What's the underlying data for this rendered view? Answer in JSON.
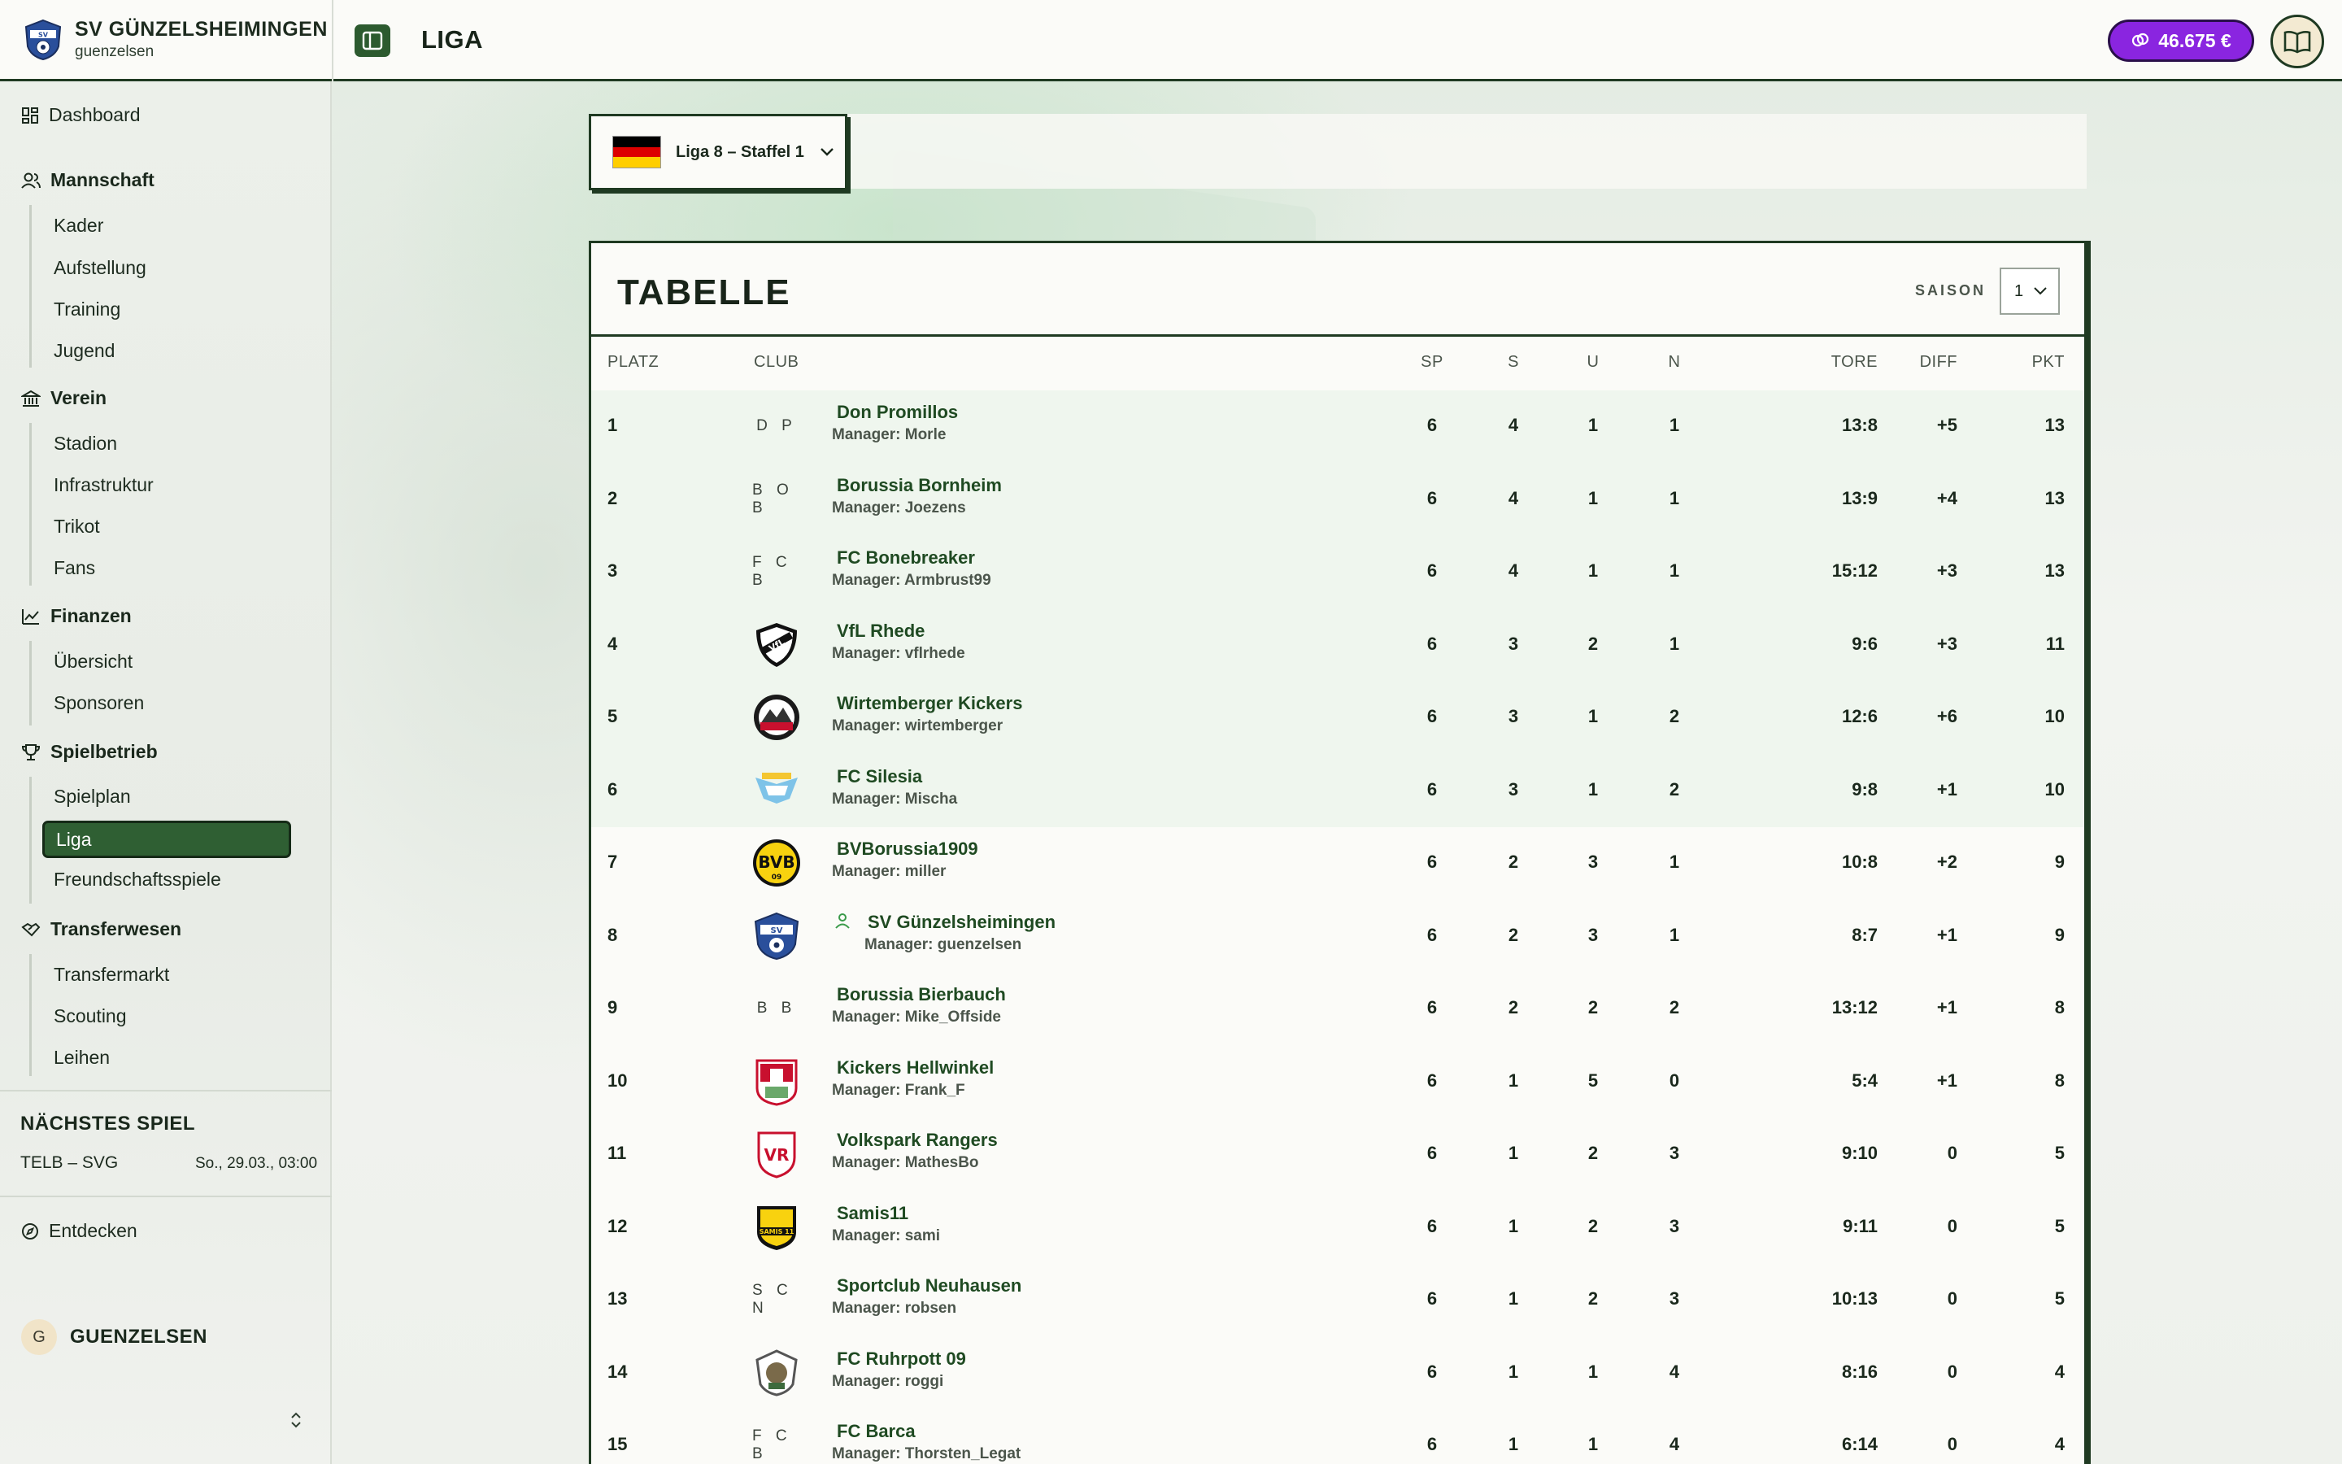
{
  "header": {
    "club_name": "SV GÜNZELSHEIMINGEN",
    "club_user": "guenzelsen",
    "page_title": "LIGA",
    "balance": "46.675 €"
  },
  "sidebar": {
    "dashboard": "Dashboard",
    "groups": [
      {
        "title": "Mannschaft",
        "icon": "users-icon",
        "items": [
          "Kader",
          "Aufstellung",
          "Training",
          "Jugend"
        ]
      },
      {
        "title": "Verein",
        "icon": "building-icon",
        "items": [
          "Stadion",
          "Infrastruktur",
          "Trikot",
          "Fans"
        ]
      },
      {
        "title": "Finanzen",
        "icon": "chart-icon",
        "items": [
          "Übersicht",
          "Sponsoren"
        ]
      },
      {
        "title": "Spielbetrieb",
        "icon": "trophy-icon",
        "items": [
          "Spielplan",
          "Liga",
          "Freundschaftsspiele"
        ]
      },
      {
        "title": "Transferwesen",
        "icon": "handshake-icon",
        "items": [
          "Transfermarkt",
          "Scouting",
          "Leihen"
        ]
      }
    ],
    "active_item": "Liga",
    "next_match_label": "NÄCHSTES SPIEL",
    "next_match": "TELB – SVG",
    "next_match_date": "So., 29.03., 03:00",
    "discover": "Entdecken",
    "user_initial": "G",
    "user_name": "GUENZELSEN"
  },
  "league": {
    "selected": "Liga 8 – Staffel 1",
    "flag_colors": [
      "#000000",
      "#dd0000",
      "#ffce00"
    ]
  },
  "table": {
    "title": "TABELLE",
    "season_label": "SAISON",
    "season_value": "1",
    "headers": [
      "PLATZ",
      "CLUB",
      "SP",
      "S",
      "U",
      "N",
      "TORE",
      "DIFF",
      "PKT"
    ],
    "rows": [
      {
        "pos": "1",
        "initials": "D P",
        "logo": "",
        "club": "Don Promillos",
        "manager": "Manager: Morle",
        "sp": "6",
        "s": "4",
        "u": "1",
        "n": "1",
        "tore": "13:8",
        "diff": "+5",
        "pkt": "13"
      },
      {
        "pos": "2",
        "initials": "B O B",
        "logo": "",
        "club": "Borussia Bornheim",
        "manager": "Manager: Joezens",
        "sp": "6",
        "s": "4",
        "u": "1",
        "n": "1",
        "tore": "13:9",
        "diff": "+4",
        "pkt": "13"
      },
      {
        "pos": "3",
        "initials": "F C B",
        "logo": "",
        "club": "FC Bonebreaker",
        "manager": "Manager: Armbrust99",
        "sp": "6",
        "s": "4",
        "u": "1",
        "n": "1",
        "tore": "15:12",
        "diff": "+3",
        "pkt": "13"
      },
      {
        "pos": "4",
        "initials": "",
        "logo": "vfl-rhede-crest-icon",
        "club": "VfL Rhede",
        "manager": "Manager: vflrhede",
        "sp": "6",
        "s": "3",
        "u": "2",
        "n": "1",
        "tore": "9:6",
        "diff": "+3",
        "pkt": "11"
      },
      {
        "pos": "5",
        "initials": "",
        "logo": "wirtemberger-kickers-crest-icon",
        "club": "Wirtemberger Kickers",
        "manager": "Manager: wirtemberger",
        "sp": "6",
        "s": "3",
        "u": "1",
        "n": "2",
        "tore": "12:6",
        "diff": "+6",
        "pkt": "10"
      },
      {
        "pos": "6",
        "initials": "",
        "logo": "fc-silesia-crest-icon",
        "club": "FC Silesia",
        "manager": "Manager: Mischa",
        "sp": "6",
        "s": "3",
        "u": "1",
        "n": "2",
        "tore": "9:8",
        "diff": "+1",
        "pkt": "10"
      },
      {
        "pos": "7",
        "initials": "",
        "logo": "bvb-crest-icon",
        "club": "BVBorussia1909",
        "manager": "Manager: miller",
        "sp": "6",
        "s": "2",
        "u": "3",
        "n": "1",
        "tore": "10:8",
        "diff": "+2",
        "pkt": "9"
      },
      {
        "pos": "8",
        "initials": "",
        "logo": "sv-guenzelsheimingen-crest-icon",
        "club": "SV Günzelsheimingen",
        "manager": "Manager: guenzelsen",
        "own": true,
        "sp": "6",
        "s": "2",
        "u": "3",
        "n": "1",
        "tore": "8:7",
        "diff": "+1",
        "pkt": "9"
      },
      {
        "pos": "9",
        "initials": "B B",
        "logo": "",
        "club": "Borussia Bierbauch",
        "manager": "Manager: Mike_Offside",
        "sp": "6",
        "s": "2",
        "u": "2",
        "n": "2",
        "tore": "13:12",
        "diff": "+1",
        "pkt": "8"
      },
      {
        "pos": "10",
        "initials": "",
        "logo": "kickers-hellwinkel-crest-icon",
        "club": "Kickers Hellwinkel",
        "manager": "Manager: Frank_F",
        "sp": "6",
        "s": "1",
        "u": "5",
        "n": "0",
        "tore": "5:4",
        "diff": "+1",
        "pkt": "8"
      },
      {
        "pos": "11",
        "initials": "",
        "logo": "volkspark-rangers-crest-icon",
        "club": "Volkspark Rangers",
        "manager": "Manager: MathesBo",
        "sp": "6",
        "s": "1",
        "u": "2",
        "n": "3",
        "tore": "9:10",
        "diff": "0",
        "pkt": "5"
      },
      {
        "pos": "12",
        "initials": "",
        "logo": "samis11-crest-icon",
        "club": "Samis11",
        "manager": "Manager: sami",
        "sp": "6",
        "s": "1",
        "u": "2",
        "n": "3",
        "tore": "9:11",
        "diff": "0",
        "pkt": "5"
      },
      {
        "pos": "13",
        "initials": "S C N",
        "logo": "",
        "club": "Sportclub Neuhausen",
        "manager": "Manager: robsen",
        "sp": "6",
        "s": "1",
        "u": "2",
        "n": "3",
        "tore": "10:13",
        "diff": "0",
        "pkt": "5"
      },
      {
        "pos": "14",
        "initials": "",
        "logo": "fc-ruhrpott-09-crest-icon",
        "club": "FC Ruhrpott 09",
        "manager": "Manager: roggi",
        "sp": "6",
        "s": "1",
        "u": "1",
        "n": "4",
        "tore": "8:16",
        "diff": "0",
        "pkt": "4"
      },
      {
        "pos": "15",
        "initials": "F C B",
        "logo": "",
        "club": "FC Barca",
        "manager": "Manager: Thorsten_Legat",
        "sp": "6",
        "s": "1",
        "u": "1",
        "n": "4",
        "tore": "6:14",
        "diff": "0",
        "pkt": "4"
      }
    ]
  },
  "colors": {
    "accent_green": "#2f5f33",
    "dark_green": "#1f3a22",
    "balance_purple": "#8a25e0",
    "promotion_row": "#e8f2e8"
  }
}
